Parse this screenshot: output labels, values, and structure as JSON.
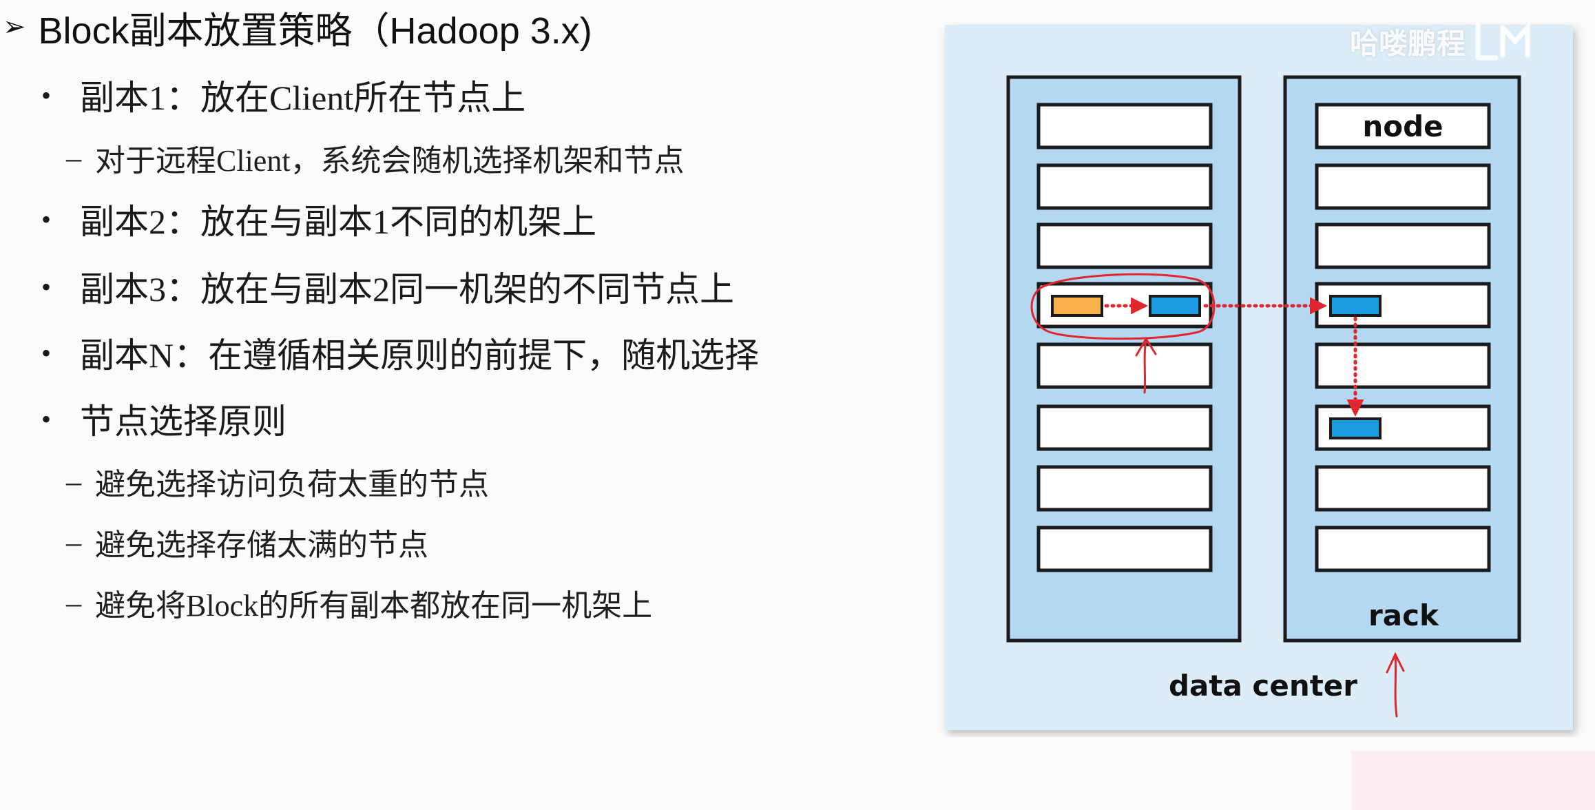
{
  "title": "Block副本放置策略（Hadoop 3.x)",
  "bullets": {
    "b1": "副本1：放在Client所在节点上",
    "b1_sub1": "对于远程Client，系统会随机选择机架和节点",
    "b2": "副本2：放在与副本1不同的机架上",
    "b3": "副本3：放在与副本2同一机架的不同节点上",
    "b4": "副本N：在遵循相关原则的前提下，随机选择",
    "b5": "节点选择原则",
    "b5_sub1": "避免选择访问负荷太重的节点",
    "b5_sub2": "避免选择存储太满的节点",
    "b5_sub3": "避免将Block的所有副本都放在同一机架上"
  },
  "diagram": {
    "node_label": "node",
    "rack_label": "rack",
    "datacenter_label": "data center",
    "colors": {
      "background": "#dcedf8",
      "rack_fill": "#b4d8f1",
      "node_fill": "#ffffff",
      "block_orange": "#f9b24e",
      "block_blue": "#1b9be0",
      "arrow_red": "#e0262e"
    }
  },
  "watermark": "哈喽鹏程"
}
